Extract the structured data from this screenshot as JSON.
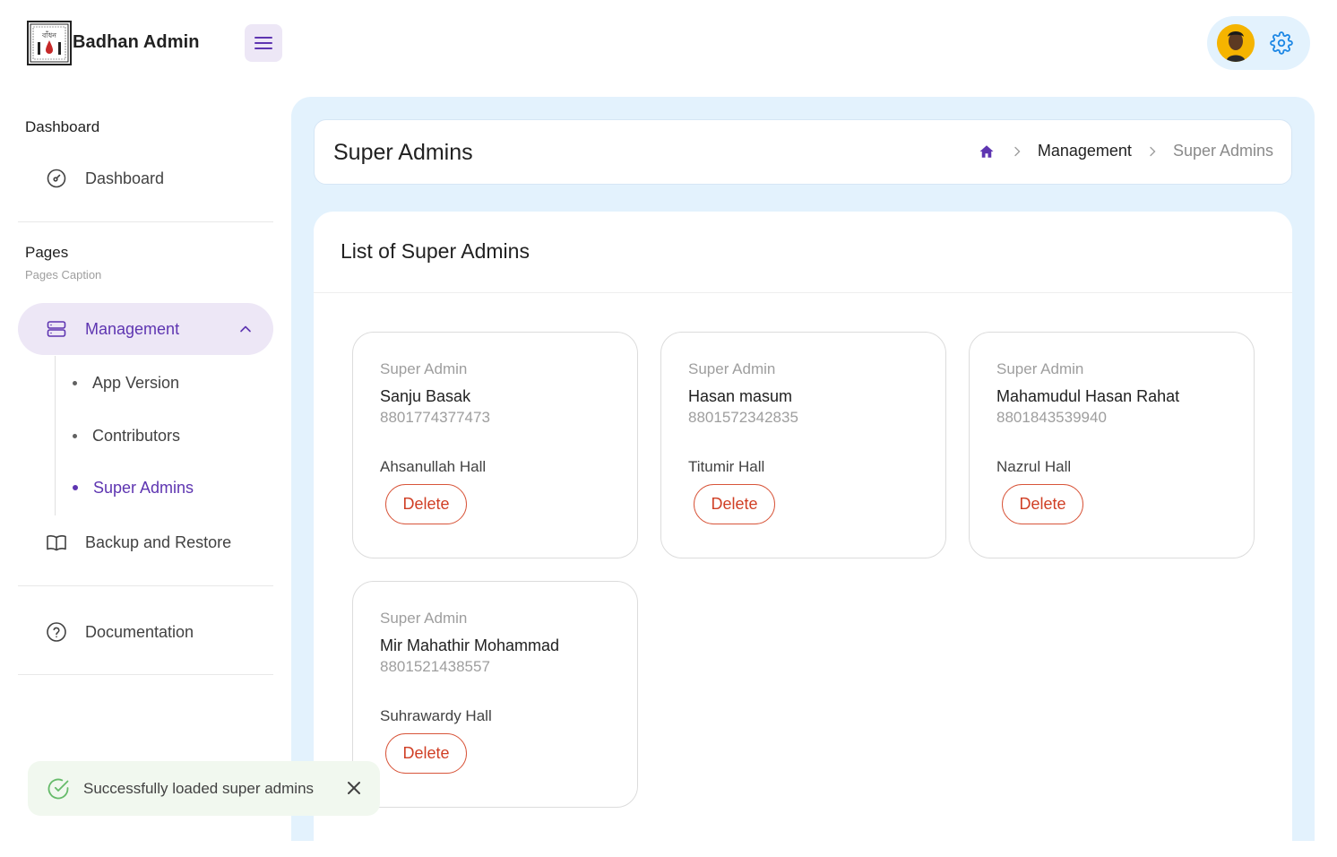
{
  "header": {
    "brand": "Badhan Admin",
    "logo_text": "বাঁধন"
  },
  "sidebar": {
    "section_dashboard": "Dashboard",
    "dashboard_item": "Dashboard",
    "section_pages": "Pages",
    "pages_caption": "Pages Caption",
    "management": "Management",
    "sub_items": [
      "App Version",
      "Contributors",
      "Super Admins"
    ],
    "backup": "Backup and Restore",
    "documentation": "Documentation"
  },
  "breadcrumb": {
    "title": "Super Admins",
    "items": [
      "Management",
      "Super Admins"
    ]
  },
  "list": {
    "title": "List of Super Admins",
    "delete_label": "Delete",
    "admins": [
      {
        "role": "Super Admin",
        "name": "Sanju Basak",
        "phone": "8801774377473",
        "hall": "Ahsanullah Hall"
      },
      {
        "role": "Super Admin",
        "name": "Hasan masum",
        "phone": "8801572342835",
        "hall": "Titumir Hall"
      },
      {
        "role": "Super Admin",
        "name": "Mahamudul Hasan Rahat",
        "phone": "8801843539940",
        "hall": "Nazrul Hall"
      },
      {
        "role": "Super Admin",
        "name": "Mir Mahathir Mohammad",
        "phone": "8801521438557",
        "hall": "Suhrawardy Hall"
      }
    ]
  },
  "toast": {
    "message": "Successfully loaded super admins"
  },
  "colors": {
    "accent": "#5e35b1",
    "accent_light": "#ede7f6",
    "main_bg": "#e3f2fd",
    "danger": "#d03f25",
    "success": "#4caf50"
  }
}
